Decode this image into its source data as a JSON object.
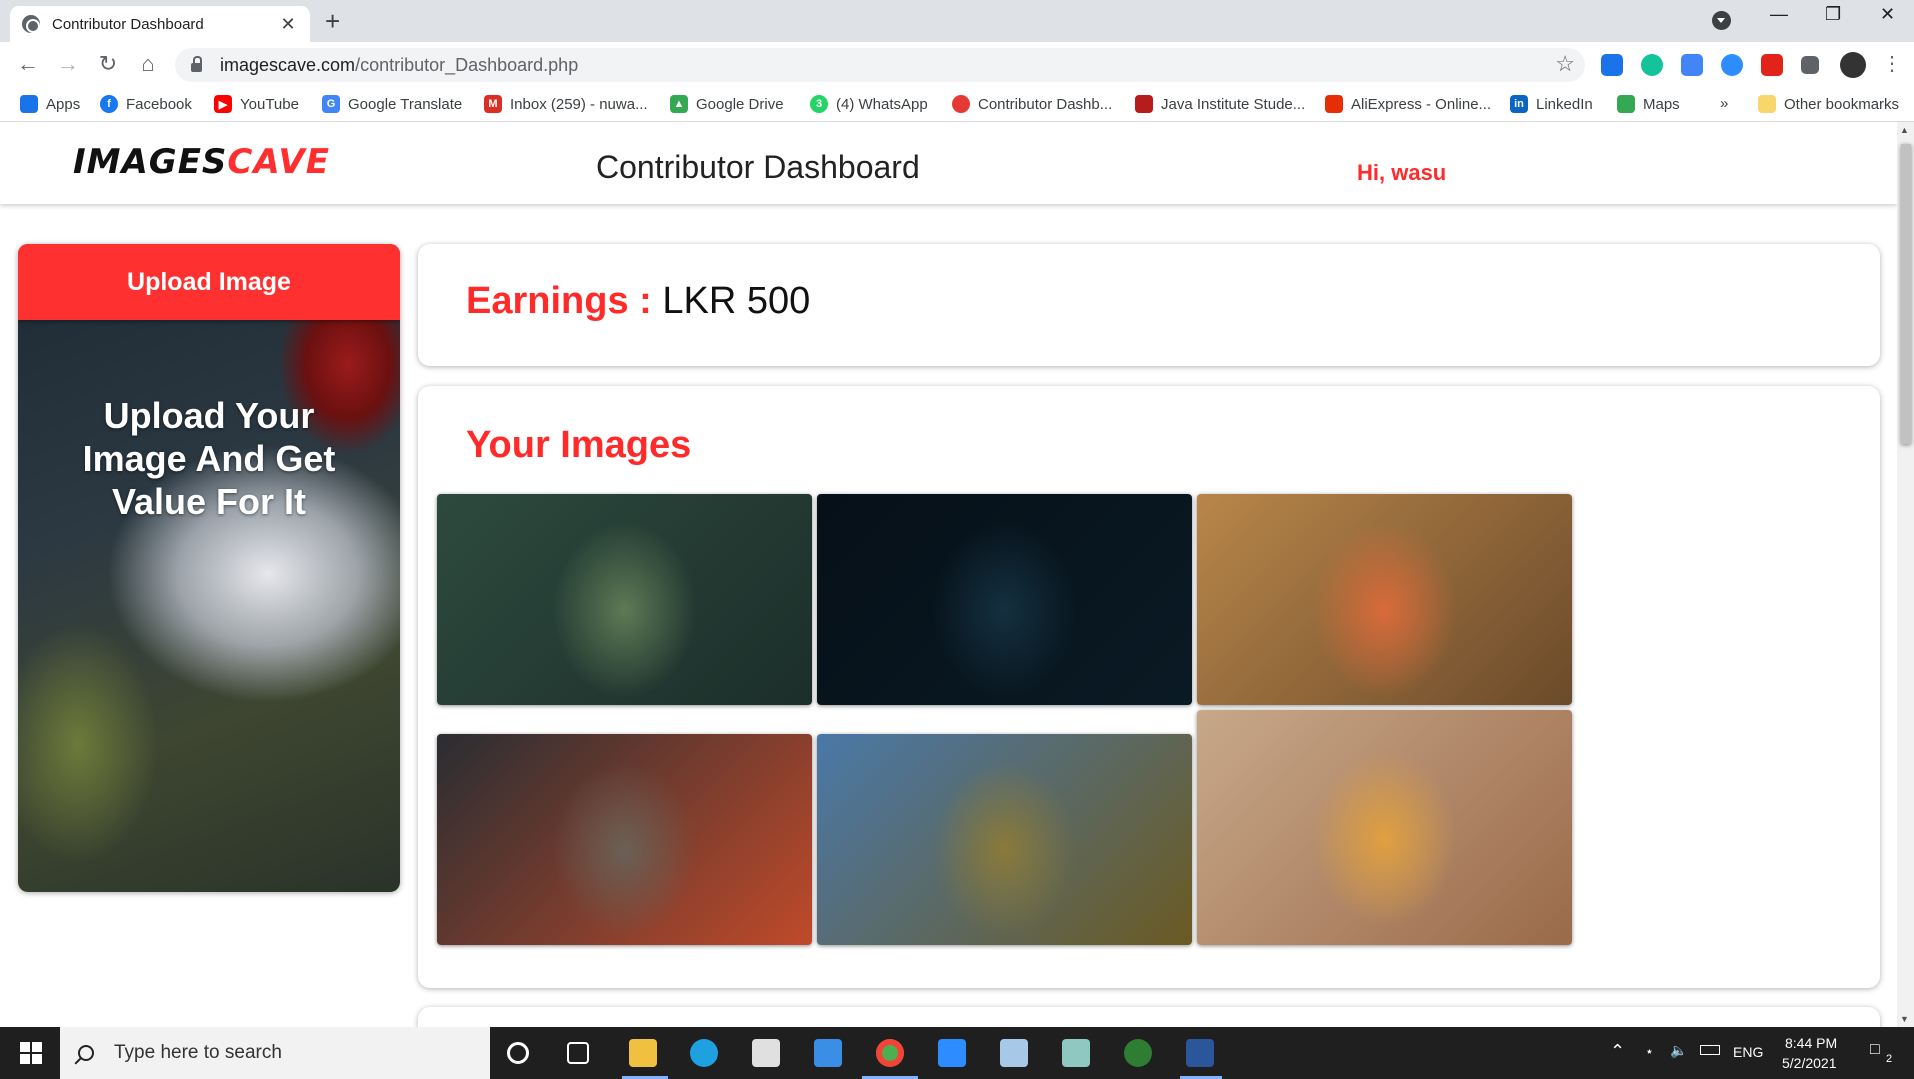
{
  "browser": {
    "tab_title": "Contributor Dashboard",
    "tab_close": "✕",
    "new_tab": "+",
    "url_host": "imagescave.com",
    "url_path": "/contributor_Dashboard.php",
    "bookmarks": [
      {
        "label": "Apps",
        "icon": "apps-grid-icon",
        "color": "#1a73e8"
      },
      {
        "label": "Facebook",
        "icon": "facebook-icon",
        "color": "#1877f2"
      },
      {
        "label": "YouTube",
        "icon": "youtube-icon",
        "color": "#ff0000"
      },
      {
        "label": "Google Translate",
        "icon": "translate-icon",
        "color": "#4285f4"
      },
      {
        "label": "Inbox (259) - nuwa...",
        "icon": "gmail-icon",
        "color": "#d93025"
      },
      {
        "label": "Google Drive",
        "icon": "drive-icon",
        "color": "#34a853"
      },
      {
        "label": "(4) WhatsApp",
        "icon": "whatsapp-icon",
        "color": "#25d366"
      },
      {
        "label": "Contributor Dashb...",
        "icon": "site-icon",
        "color": "#e53935"
      },
      {
        "label": "Java Institute Stude...",
        "icon": "java-institute-icon",
        "color": "#b71c1c"
      },
      {
        "label": "AliExpress - Online...",
        "icon": "aliexpress-icon",
        "color": "#e62e04"
      },
      {
        "label": "LinkedIn",
        "icon": "linkedin-icon",
        "color": "#0a66c2"
      },
      {
        "label": "Maps",
        "icon": "maps-icon",
        "color": "#34a853"
      }
    ],
    "bookmarks_overflow": "»",
    "other_bookmarks": "Other bookmarks"
  },
  "site": {
    "logo_part1": "IMAGES",
    "logo_part2": "CAVE",
    "page_title": "Contributor Dashboard",
    "greeting": "Hi, wasu",
    "upload_button": "Upload Image",
    "promo_text": "Upload Your Image And Get Value For It",
    "earnings_label": "Earnings : ",
    "earnings_value": "LKR 500",
    "images_title": "Your Images",
    "images": [
      {
        "name": "panda",
        "colors": [
          "#2d4a3e",
          "#5d7a55",
          "#1c2e2a"
        ]
      },
      {
        "name": "city-night",
        "colors": [
          "#061018",
          "#143040",
          "#0a1a24"
        ]
      },
      {
        "name": "pizza",
        "colors": [
          "#b8864a",
          "#d96a3a",
          "#6b4a2a"
        ]
      },
      {
        "name": "pebbles",
        "colors": [
          "#2a2d32",
          "#6b6055",
          "#c04a2a"
        ]
      },
      {
        "name": "lion",
        "colors": [
          "#4a78a8",
          "#8a7a3a",
          "#6b5a22"
        ]
      },
      {
        "name": "fast-food",
        "colors": [
          "#c8a88a",
          "#e0a040",
          "#9a6a4a"
        ]
      }
    ]
  },
  "taskbar": {
    "search_placeholder": "Type here to search",
    "language": "ENG",
    "time": "8:44 PM",
    "date": "5/2/2021",
    "notifications": "2"
  }
}
